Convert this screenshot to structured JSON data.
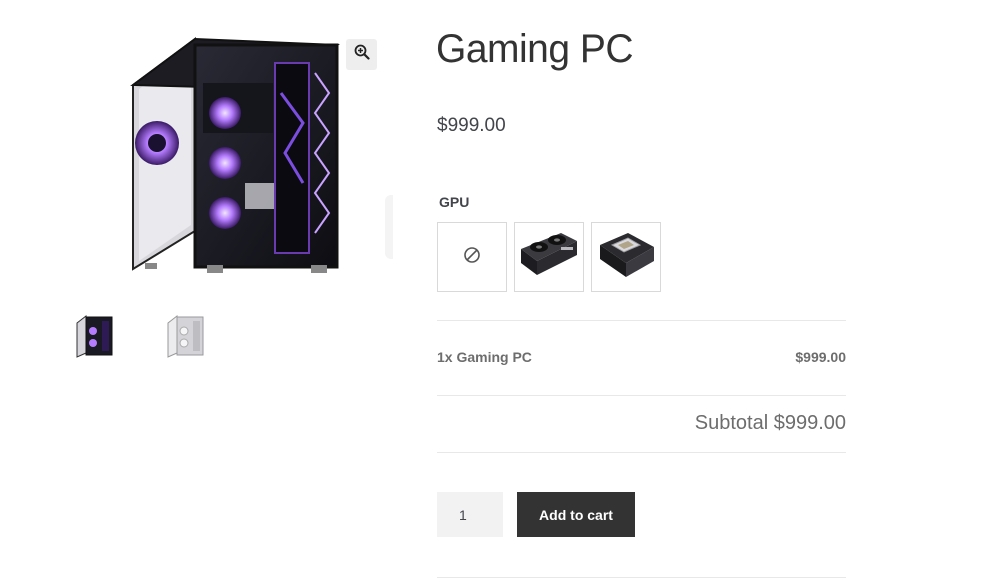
{
  "product": {
    "title": "Gaming PC",
    "price": "$999.00",
    "main_image": "gaming-pc-case-purple-rgb",
    "thumbnails": [
      "gaming-pc-case-dark",
      "gaming-pc-case-white"
    ]
  },
  "gallery": {
    "zoom_icon": "magnify-plus-icon"
  },
  "attribute": {
    "label": "GPU",
    "options": [
      {
        "name": "none",
        "icon": "no-selection-icon"
      },
      {
        "name": "graphics-card-front",
        "icon": "gpu-card-image"
      },
      {
        "name": "graphics-card-chip",
        "icon": "gpu-chip-image"
      }
    ]
  },
  "summary": {
    "line_label": "1x Gaming PC",
    "line_price": "$999.00",
    "subtotal_text": "Subtotal $999.00"
  },
  "cart": {
    "quantity": "1",
    "add_label": "Add to cart"
  },
  "colors": {
    "button_bg": "#333333",
    "button_text": "#ffffff",
    "accent_purple": "#b57cff"
  }
}
